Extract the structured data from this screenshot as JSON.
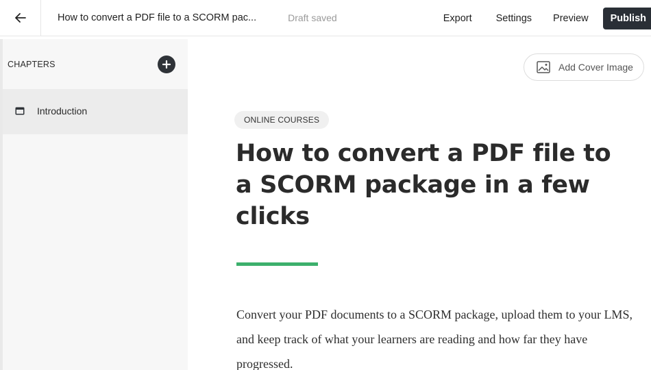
{
  "topbar": {
    "back_icon": "arrow-left-icon",
    "title": "How to convert a PDF file to a SCORM pac...",
    "status": "Draft saved",
    "export_label": "Export",
    "settings_label": "Settings",
    "preview_label": "Preview",
    "publish_label": "Publish"
  },
  "sidebar": {
    "header": "CHAPTERS",
    "add_icon": "plus-circle-icon",
    "items": [
      {
        "label": "Introduction",
        "icon": "chapter-window-icon"
      }
    ]
  },
  "main": {
    "cover_button_label": "Add Cover Image",
    "cover_icon": "image-icon",
    "category": "ONLINE COURSES",
    "title": "How to convert a PDF file to a SCORM package in a few clicks",
    "intro": "Convert your PDF documents to a SCORM package, upload them to your LMS, and keep track of what your learners are reading and how far they have progressed."
  },
  "colors": {
    "accent_rule": "#3cb06c",
    "publish_bg": "#2a2f36",
    "sidebar_bg": "#f7f7f7",
    "active_chapter_bg": "#ececec"
  }
}
